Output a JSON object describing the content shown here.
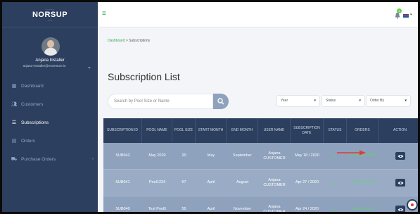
{
  "brand": {
    "tag": "─────",
    "name": "NORSUP",
    "sub": "───"
  },
  "user": {
    "name": "Anjana Installer",
    "email": "anjana+installer@noventure.in"
  },
  "nav": [
    {
      "label": "Dashboard",
      "icon": "dashboard-icon"
    },
    {
      "label": "Customers",
      "icon": "users-icon"
    },
    {
      "label": "Subscriptions",
      "icon": "list-icon",
      "active": true
    },
    {
      "label": "Orders",
      "icon": "orders-icon"
    },
    {
      "label": "Purchase Orders",
      "icon": "cart-icon",
      "chevron": "›"
    }
  ],
  "topbar": {
    "menu_icon": "≡",
    "notif_count": "1",
    "lang_caret": "▾"
  },
  "breadcrumb": {
    "home": "Dashboard",
    "sep": ">",
    "current": "Subscriptions"
  },
  "page_title": "Subscription List",
  "search": {
    "placeholder": "Search by Pool Size or Name"
  },
  "filters": {
    "year": "Year",
    "status": "Status",
    "order_by": "Order By",
    "caret": "▾"
  },
  "table": {
    "headers": [
      "SUBSCRIPTION ID",
      "POOL NAME",
      "POOL SIZE",
      "START MONTH",
      "END MONTH",
      "USER NAME",
      "SUBSCRIPTION DATE",
      "STATUS",
      "ORDERS",
      "ACTION"
    ],
    "rows": [
      {
        "id": "SUB042",
        "pool_name": "May 2020",
        "pool_size": "20",
        "start": "May",
        "end": "September",
        "user": "Anjana CUSTOMER",
        "date": "May 18 / 2020",
        "status": "✓",
        "orders": "Generate Order"
      },
      {
        "id": "SUB041",
        "pool_name": "Pool1234",
        "pool_size": "67",
        "start": "April",
        "end": "August",
        "user": "Anjana CUSTOMER",
        "date": "Apr 27 / 2020",
        "status": "✓",
        "orders": "View Orders"
      },
      {
        "id": "SUB040",
        "pool_name": "Test Pool5",
        "pool_size": "55",
        "start": "April",
        "end": "November",
        "user": "Anjana CUSTOMER",
        "date": "Apr 24 / 2020",
        "status": "✓",
        "orders": "View Orders"
      }
    ]
  },
  "colors": {
    "sidebar": "#2c3f5e",
    "accent": "#2fa84f",
    "row": "#8ea1bd",
    "arrow": "#e53935"
  }
}
